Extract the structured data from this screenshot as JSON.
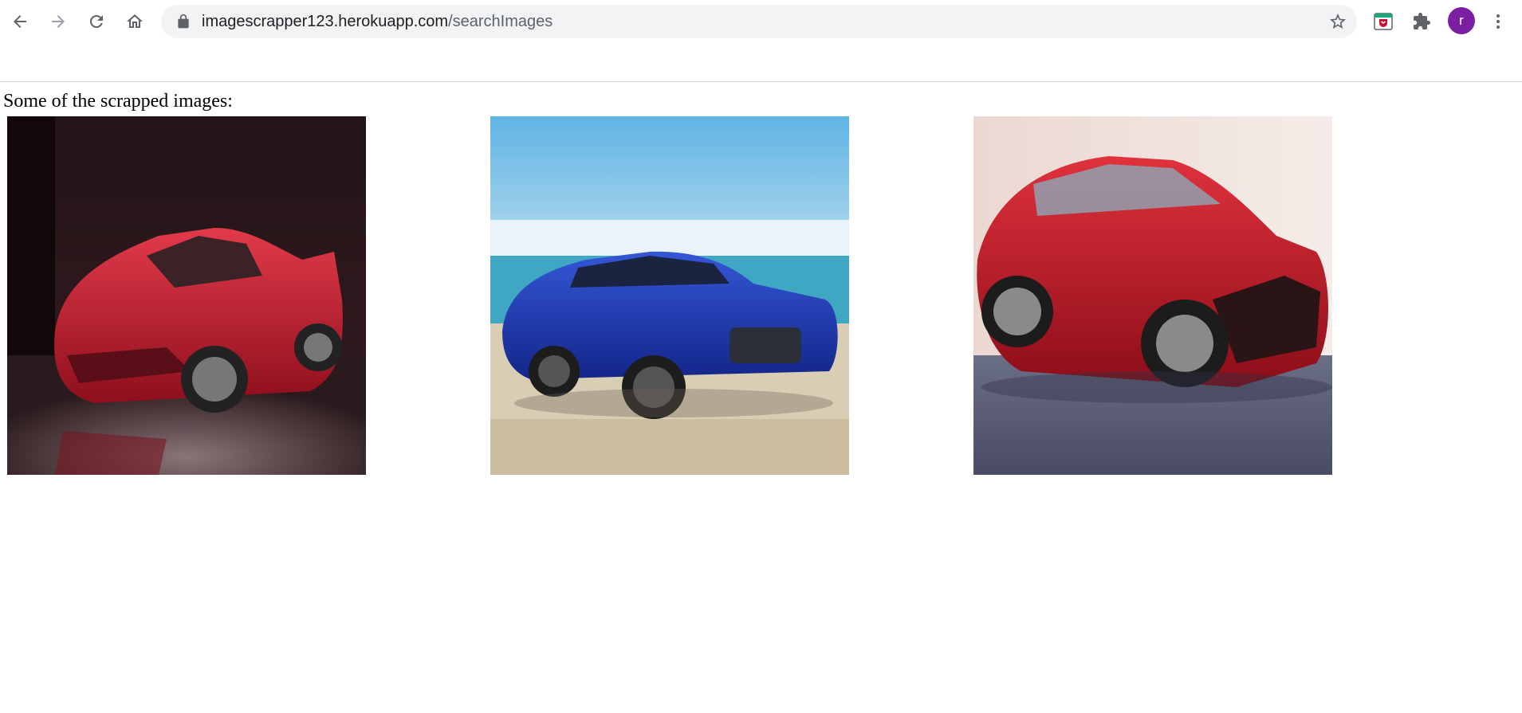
{
  "browser": {
    "url_host": "imagescrapper123.herokuapp.com",
    "url_path": "/searchImages",
    "profile_initial": "r",
    "icons": [
      "back-arrow-icon",
      "forward-arrow-icon",
      "reload-icon",
      "home-icon",
      "lock-icon",
      "bookmark-star-icon",
      "extension-shield-icon",
      "puzzle-extensions-icon",
      "kebab-menu-icon"
    ],
    "accent_color": "#7b1fa2"
  },
  "page": {
    "caption": "Some of the scrapped images:",
    "images": [
      {
        "subject": "red sports car",
        "dominant_color": "#c0162a"
      },
      {
        "subject": "blue sedan on beach",
        "dominant_color": "#1f3fb8"
      },
      {
        "subject": "red sedan",
        "dominant_color": "#c41a24"
      }
    ]
  }
}
